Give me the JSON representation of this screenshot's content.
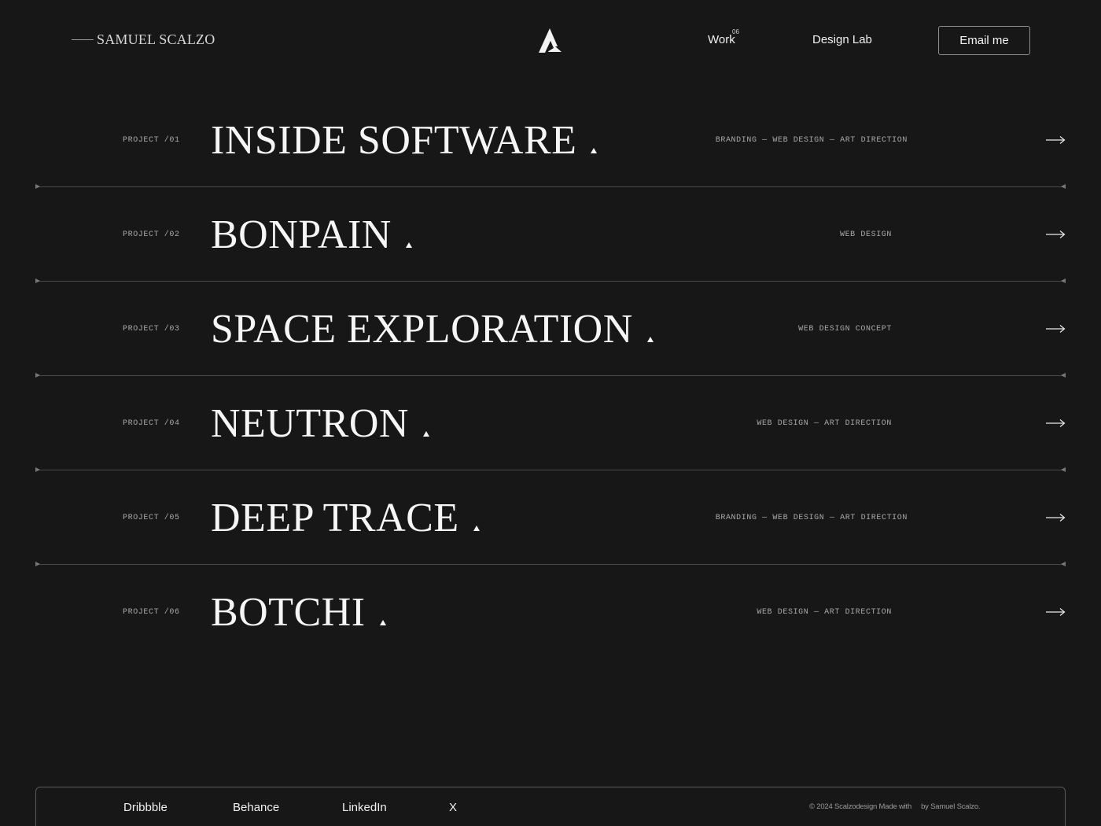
{
  "header": {
    "brand": "SAMUEL SCALZO",
    "nav": {
      "work_label": "Work",
      "work_count": "06",
      "design_lab_label": "Design Lab"
    },
    "email_button_label": "Email me"
  },
  "projects": [
    {
      "number": "PROJECT /01",
      "title": "INSIDE SOFTWARE",
      "tags": "BRANDING — WEB DESIGN — ART DIRECTION"
    },
    {
      "number": "PROJECT /02",
      "title": "BONPAIN",
      "tags": "WEB DESIGN"
    },
    {
      "number": "PROJECT /03",
      "title": "SPACE EXPLORATION",
      "tags": "WEB DESIGN CONCEPT"
    },
    {
      "number": "PROJECT /04",
      "title": "NEUTRON",
      "tags": "WEB DESIGN — ART DIRECTION"
    },
    {
      "number": "PROJECT /05",
      "title": "DEEP TRACE",
      "tags": "BRANDING — WEB DESIGN — ART DIRECTION"
    },
    {
      "number": "PROJECT /06",
      "title": "BOTCHI",
      "tags": "WEB DESIGN — ART DIRECTION"
    }
  ],
  "footer": {
    "socials": [
      "Dribbble",
      "Behance",
      "LinkedIn",
      "X"
    ],
    "copyright_left": "© 2024 Scalzodesign Made with",
    "copyright_right": "by Samuel Scalzo."
  },
  "colors": {
    "background": "#171717",
    "text": "#f6f6f6",
    "muted": "#a9a9a9",
    "divider": "#4a4a4a"
  }
}
